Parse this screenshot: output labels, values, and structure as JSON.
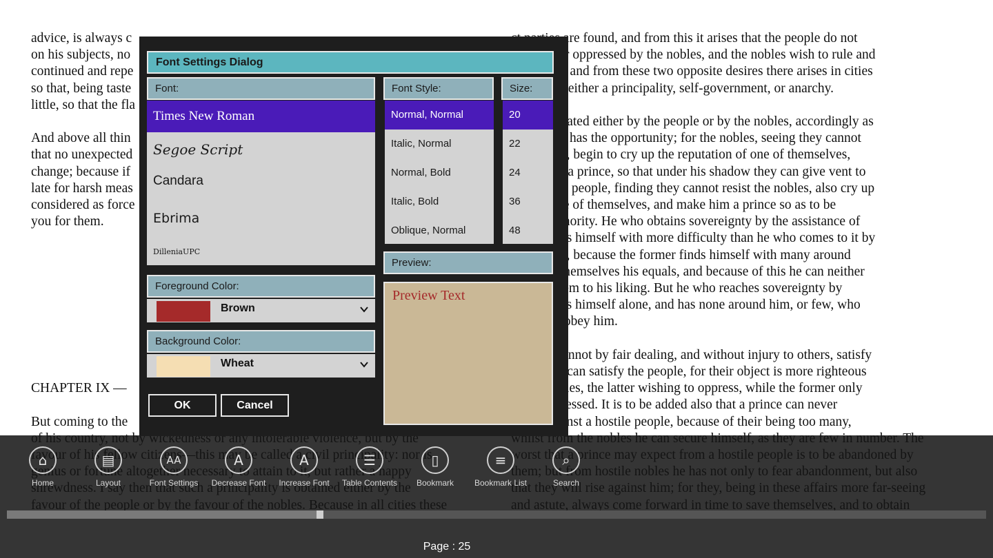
{
  "book": {
    "left_lines": [
      "advice, is always c",
      "on his subjects, no",
      "continued and repe",
      "so that, being taste",
      "little, so that the fla",
      "",
      "And above all thin",
      "that no unexpected",
      "change; because if",
      "late for harsh meas",
      "considered as force",
      "you for them.",
      "",
      "",
      "",
      "",
      "",
      "",
      "",
      "",
      "",
      "CHAPTER IX —",
      "",
      "But coming to the",
      "of his country, not by wickedness or any intolerable violence, but by the",
      "favour of his fellow citizens—this may be called a civil principality: nor is",
      "genius or fortune altogether necessary to attain to it, but rather a happy",
      "shrewdness. I say then that such a principality is obtained either by the",
      "favour of the people or by the favour of the nobles. Because in all cities these"
    ],
    "right_lines": [
      "ct parties are found, and from this it arises that the people do not",
      "e ruled nor oppressed by the nobles, and the nobles wish to rule and",
      "he people; and from these two opposite desires there arises in cities",
      "ee results, either a principality, self-government, or anarchy.",
      "",
      "ality is created either by the people or by the nobles, accordingly as",
      "er of them has the opportunity; for the nobles, seeing they cannot",
      "the people, begin to cry up the reputation of one of themselves,",
      "make him a prince, so that under his shadow they can give vent to",
      "itions. The people, finding they cannot resist the nobles, also cry up",
      "tion of one of themselves, and make him a prince so as to be",
      "by his authority. He who obtains sovereignty by the assistance of",
      "s maintains himself with more difficulty than he who comes to it by",
      "the people, because the former finds himself with many around",
      "consider themselves his equals, and because of this he can neither",
      "nanage them to his liking. But he who reaches sovereignty by",
      "avour finds himself alone, and has none around him, or few, who",
      "epared to obey him.",
      "",
      "his, one cannot by fair dealing, and without injury to others, satisfy",
      "s, but you can satisfy the people, for their object is more righteous",
      "of the nobles, the latter wishing to oppress, while the former only",
      "to be oppressed. It is to be added also that a prince can never",
      "mself against a hostile people, because of their being too many,",
      "whilst from the nobles he can secure himself, as they are few in number. The",
      "worst that a prince may expect from a hostile people is to be abandoned by",
      "them; but from hostile nobles he has not only to fear abandonment, but also",
      "that they will rise against him; for they, being in these affairs more far-seeing",
      "and astute, always come forward in time to save themselves, and to obtain"
    ]
  },
  "dialog": {
    "title": "Font Settings Dialog",
    "font_label": "Font:",
    "fonts": [
      {
        "label": "Times New Roman",
        "selected": true
      },
      {
        "label": "Segoe Script",
        "selected": false
      },
      {
        "label": "Candara",
        "selected": false
      },
      {
        "label": "Ebrima",
        "selected": false
      },
      {
        "label": "DilleniaUPC",
        "selected": false
      }
    ],
    "style_label": "Font Style:",
    "styles": [
      {
        "label": "Normal, Normal",
        "selected": true
      },
      {
        "label": "Italic, Normal",
        "selected": false
      },
      {
        "label": "Normal, Bold",
        "selected": false
      },
      {
        "label": "Italic, Bold",
        "selected": false
      },
      {
        "label": "Oblique, Normal",
        "selected": false
      }
    ],
    "size_label": "Size:",
    "sizes": [
      {
        "label": "20",
        "selected": true
      },
      {
        "label": "22",
        "selected": false
      },
      {
        "label": "24",
        "selected": false
      },
      {
        "label": "36",
        "selected": false
      },
      {
        "label": "48",
        "selected": false
      }
    ],
    "foreground_label": "Foreground Color:",
    "foreground_value": "Brown",
    "foreground_color": "#a52a2a",
    "background_label": "Background Color:",
    "background_value": "Wheat",
    "background_color": "#f5deb3",
    "preview_label": "Preview:",
    "preview_text": "Preview Text",
    "ok_label": "OK",
    "cancel_label": "Cancel"
  },
  "app_bar": {
    "buttons": [
      {
        "label": "Home",
        "icon": "home-icon"
      },
      {
        "label": "Layout",
        "icon": "book-icon"
      },
      {
        "label": "Font Settings",
        "icon": "font-settings-icon"
      },
      {
        "label": "Decrease Font",
        "icon": "decrease-font-icon"
      },
      {
        "label": "Increase Font",
        "icon": "increase-font-icon"
      },
      {
        "label": "Table Contents",
        "icon": "list-icon"
      },
      {
        "label": "Bookmark",
        "icon": "document-icon"
      },
      {
        "label": "Bookmark List",
        "icon": "bookmark-list-icon"
      },
      {
        "label": "Search",
        "icon": "search-icon"
      }
    ],
    "progress": 0.32,
    "page_text": "Page : 25"
  },
  "colors": {
    "accent_selection": "#4a1bb8",
    "title_bar": "#5cb6bf",
    "header": "#8fb0ba"
  }
}
